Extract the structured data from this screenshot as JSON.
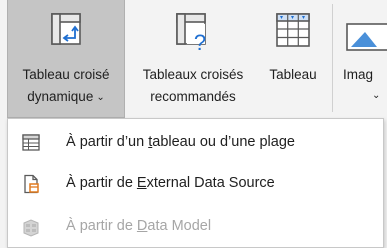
{
  "ribbon": {
    "pivot_table": {
      "line1": "Tableau croisé",
      "line2": "dynamique",
      "chevron": "⌄"
    },
    "recommended_pivot": {
      "line1": "Tableaux croisés",
      "line2": "recommandés"
    },
    "table": {
      "line1": "Tableau"
    },
    "images": {
      "line1": "Imag",
      "chevron": "⌄"
    }
  },
  "menu": {
    "items": [
      {
        "pre": "À partir d’un ",
        "key": "t",
        "post": "ableau ou d’une plage",
        "icon": "table-range-icon",
        "enabled": true
      },
      {
        "pre": "À partir de ",
        "key": "E",
        "post": "xternal Data Source",
        "icon": "external-source-icon",
        "enabled": true
      },
      {
        "pre": "À partir de ",
        "key": "D",
        "post": "ata Model",
        "icon": "data-model-icon",
        "enabled": false
      }
    ]
  },
  "colors": {
    "accent_blue": "#1f6fd1",
    "accent_orange": "#e07a1f",
    "pressed_bg": "#c5c5c5",
    "disabled_text": "#a6a6a6"
  }
}
